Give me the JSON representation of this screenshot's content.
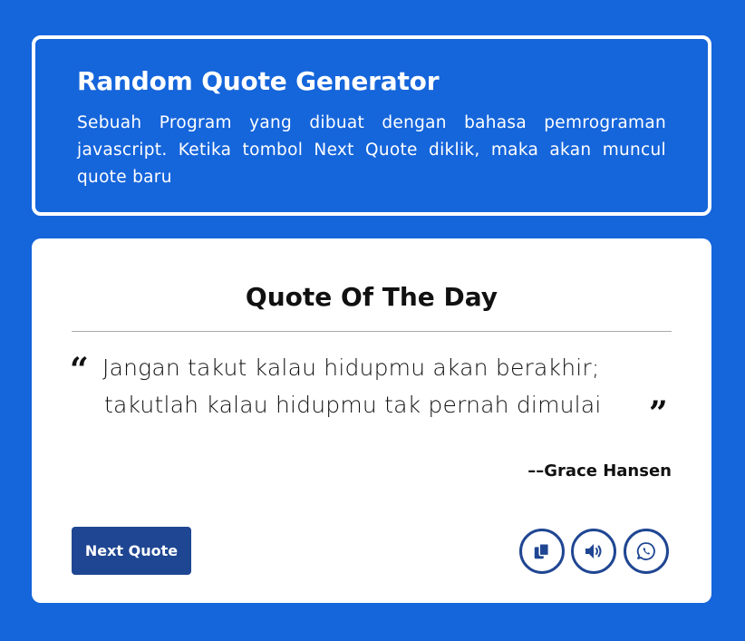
{
  "info": {
    "title": "Random Quote Generator",
    "description": "Sebuah Program yang dibuat dengan bahasa pemrograman javascript. Ketika tombol Next Quote diklik, maka akan muncul quote baru"
  },
  "quote": {
    "heading": "Quote Of The Day",
    "open_mark": "“",
    "close_mark": "”",
    "line1": "Jangan takut kalau hidupmu akan berakhir;",
    "line2": "takutlah kalau hidupmu tak pernah dimulai",
    "author": "––Grace Hansen",
    "next_button": "Next Quote"
  },
  "actions": [
    {
      "icon": "copy-icon"
    },
    {
      "icon": "speaker-icon"
    },
    {
      "icon": "whatsapp-icon"
    }
  ],
  "colors": {
    "background": "#1565db",
    "card": "#ffffff",
    "button": "#1f4692"
  }
}
